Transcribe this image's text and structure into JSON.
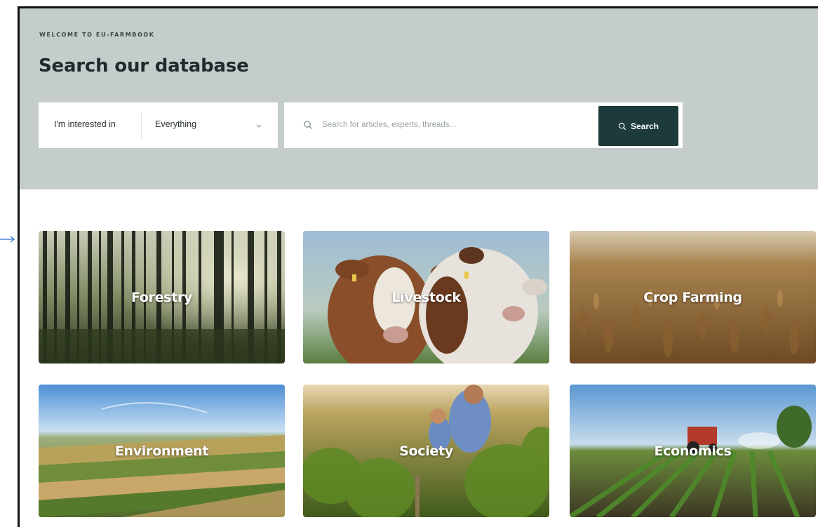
{
  "hero": {
    "eyebrow": "WELCOME TO EU-FARMBOOK",
    "title": "Search our database"
  },
  "filter": {
    "label": "I'm interested in",
    "selected": "Everything",
    "chevron_icon": "chevron-down-icon"
  },
  "search": {
    "placeholder": "Search for articles, experts, threads...",
    "value": "",
    "button_label": "Search",
    "icon": "search-icon"
  },
  "categories": [
    {
      "label": "Forestry"
    },
    {
      "label": "Livestock"
    },
    {
      "label": "Crop Farming"
    },
    {
      "label": "Environment"
    },
    {
      "label": "Society"
    },
    {
      "label": "Economics"
    }
  ],
  "colors": {
    "hero_bg": "#c5cdcc",
    "button_bg": "#1d3b3b",
    "title_text": "#1f2b2a"
  }
}
